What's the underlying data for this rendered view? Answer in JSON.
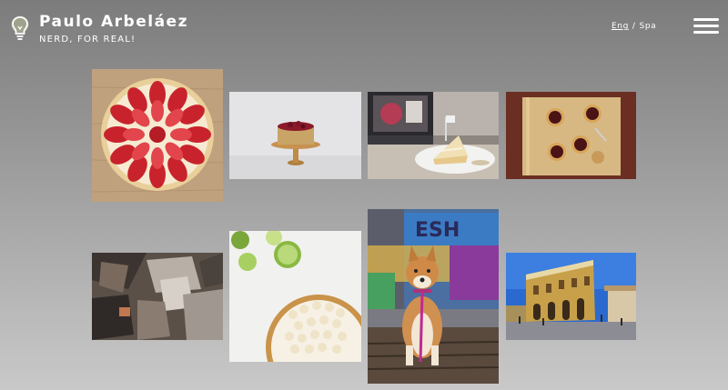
{
  "header": {
    "name": "Paulo Arbeláez",
    "tagline": "NERD, FOR REAL!",
    "logo_icon": "lightbulb-icon",
    "menu_icon": "hamburger-menu-icon"
  },
  "language": {
    "options": [
      "Eng",
      "Spa"
    ],
    "separator": "/",
    "selected": "Eng"
  },
  "gallery": {
    "photos": [
      {
        "subject": "strawberry-tart-photo"
      },
      {
        "subject": "cake-on-stand-photo"
      },
      {
        "subject": "cake-slice-and-laptop-photo"
      },
      {
        "subject": "mini-tarts-on-board-photo"
      },
      {
        "subject": "aerial-rooftops-photo"
      },
      {
        "subject": "lime-meringue-tart-photo"
      },
      {
        "subject": "shiba-dog-graffiti-photo"
      },
      {
        "subject": "colonial-plaza-photo"
      }
    ]
  }
}
